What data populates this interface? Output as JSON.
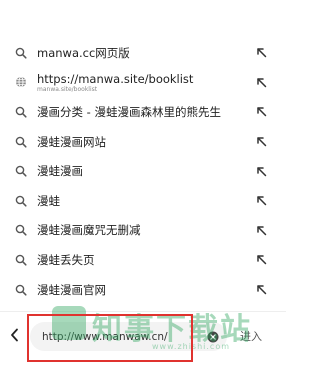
{
  "suggestions": [
    {
      "type": "search",
      "title": "manwa.cc网页版"
    },
    {
      "type": "history",
      "title": "https://manwa.site/booklist",
      "subtitle": "manwa.site/booklist"
    },
    {
      "type": "search",
      "title": "漫画分类 - 漫蛙漫画森林里的熊先生"
    },
    {
      "type": "search",
      "title": "漫蛙漫画网站"
    },
    {
      "type": "search",
      "title": "漫蛙漫画"
    },
    {
      "type": "search",
      "title": "漫蛙"
    },
    {
      "type": "search",
      "title": "漫蛙漫画魔咒无删减"
    },
    {
      "type": "search",
      "title": "漫蛙丢失页"
    },
    {
      "type": "search",
      "title": "漫蛙漫画官网"
    }
  ],
  "bottom_bar": {
    "url_value": "http://www.manwaw.cn/",
    "enter_label": "进入"
  },
  "watermark": {
    "text": "知事下载站",
    "subtitle": "www.zhishi.com"
  },
  "colors": {
    "highlight_box": "#e0332f",
    "watermark": "#2fa760"
  },
  "icons": {
    "search": "search-icon",
    "history": "globe-icon",
    "fill": "arrow-up-left-icon",
    "back": "chevron-left-icon",
    "clear": "clear-circle-icon"
  }
}
